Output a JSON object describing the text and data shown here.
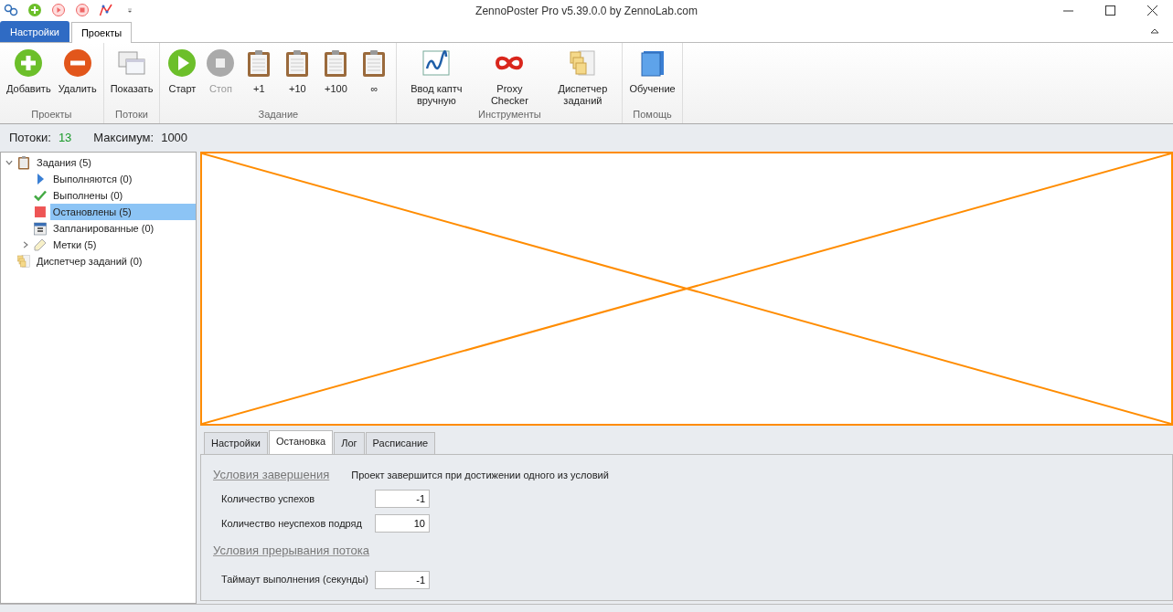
{
  "window": {
    "title": "ZennoPoster Pro v5.39.0.0 by ZennoLab.com"
  },
  "ribbon_tabs": [
    {
      "label": "Настройки",
      "selected": false
    },
    {
      "label": "Проекты",
      "selected": true
    }
  ],
  "ribbon_groups": [
    {
      "label": "Проекты",
      "buttons": [
        {
          "label": "Добавить",
          "disabled": false
        },
        {
          "label": "Удалить",
          "disabled": false
        }
      ]
    },
    {
      "label": "Потоки",
      "buttons": [
        {
          "label": "Показать",
          "disabled": false
        }
      ]
    },
    {
      "label": "Задание",
      "buttons": [
        {
          "label": "Старт",
          "disabled": false
        },
        {
          "label": "Стоп",
          "disabled": true
        },
        {
          "label": "+1",
          "disabled": false
        },
        {
          "label": "+10",
          "disabled": false
        },
        {
          "label": "+100",
          "disabled": false
        },
        {
          "label": "∞",
          "disabled": false
        }
      ]
    },
    {
      "label": "Инструменты",
      "buttons": [
        {
          "label": "Ввод каптч вручную",
          "disabled": false
        },
        {
          "label": "Proxy Checker",
          "disabled": false
        },
        {
          "label": "Диспетчер заданий",
          "disabled": false
        }
      ]
    },
    {
      "label": "Помощь",
      "buttons": [
        {
          "label": "Обучение",
          "disabled": false
        }
      ]
    }
  ],
  "status": {
    "threads_label": "Потоки:",
    "threads_value": "13",
    "max_label": "Максимум:",
    "max_value": "1000"
  },
  "tree": [
    {
      "label": "Задания (5)",
      "expanded": true,
      "selected": false,
      "children": [
        {
          "label": "Выполняются (0)",
          "selected": false
        },
        {
          "label": "Выполнены (0)",
          "selected": false
        },
        {
          "label": "Остановлены (5)",
          "selected": true
        },
        {
          "label": "Запланированные (0)",
          "selected": false
        },
        {
          "label": "Метки (5)",
          "expanded": false,
          "selected": false
        }
      ]
    },
    {
      "label": "Диспетчер заданий (0)",
      "selected": false
    }
  ],
  "detail_tabs": [
    {
      "label": "Настройки",
      "selected": false
    },
    {
      "label": "Остановка",
      "selected": true
    },
    {
      "label": "Лог",
      "selected": false
    },
    {
      "label": "Расписание",
      "selected": false
    }
  ],
  "completion": {
    "heading": "Условия завершения",
    "note": "Проект завершится при достижении одного из условий",
    "fields": [
      {
        "label": "Количество успехов",
        "value": "-1"
      },
      {
        "label": "Количество неуспехов подряд",
        "value": "10"
      }
    ]
  },
  "interruption": {
    "heading": "Условия прерывания потока",
    "fields": [
      {
        "label": "Таймаут выполнения (секунды)",
        "value": "-1"
      }
    ]
  }
}
